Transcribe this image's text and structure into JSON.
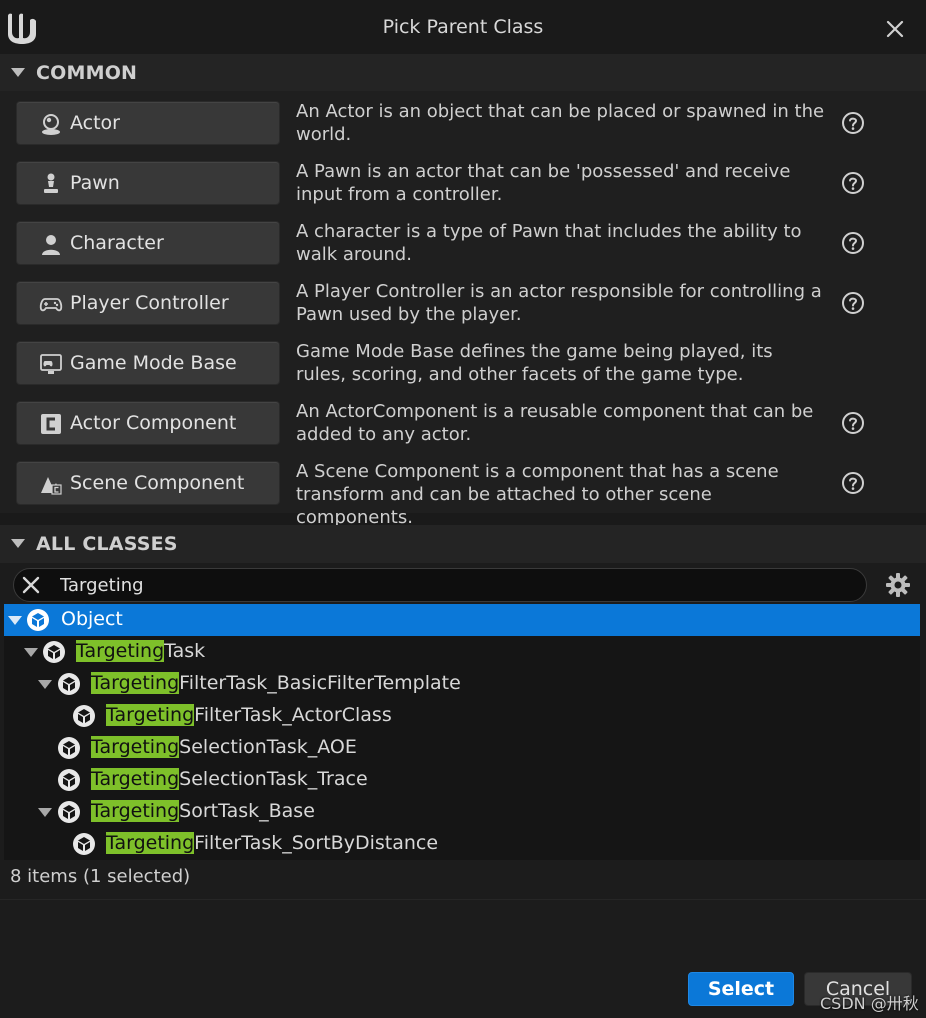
{
  "window": {
    "title": "Pick Parent Class",
    "logo": "unreal-logo",
    "close_icon": "close-icon"
  },
  "common": {
    "header": "COMMON",
    "items": [
      {
        "label": "Actor",
        "icon": "actor-icon",
        "description": "An Actor is an object that can be placed or spawned in the world.",
        "has_help": true
      },
      {
        "label": "Pawn",
        "icon": "pawn-icon",
        "description": "A Pawn is an actor that can be 'possessed' and receive input from a controller.",
        "has_help": true
      },
      {
        "label": "Character",
        "icon": "character-icon",
        "description": "A character is a type of Pawn that includes the ability to walk around.",
        "has_help": true
      },
      {
        "label": "Player Controller",
        "icon": "gamepad-icon",
        "description": "A Player Controller is an actor responsible for controlling a Pawn used by the player.",
        "has_help": true
      },
      {
        "label": "Game Mode Base",
        "icon": "game-mode-icon",
        "description": "Game Mode Base defines the game being played, its rules, scoring, and other facets of the game type.",
        "has_help": false
      },
      {
        "label": "Actor Component",
        "icon": "actor-component-icon",
        "description": "An ActorComponent is a reusable component that can be added to any actor.",
        "has_help": true
      },
      {
        "label": "Scene Component",
        "icon": "scene-component-icon",
        "description": "A Scene Component is a component that has a scene transform and can be attached to other scene components.",
        "has_help": true
      }
    ]
  },
  "all_classes": {
    "header": "ALL CLASSES",
    "search": {
      "value": "Targeting",
      "placeholder": ""
    },
    "tree": [
      {
        "highlight": "",
        "rest": "Object",
        "expanded": true,
        "selected": true
      },
      {
        "highlight": "Targeting",
        "rest": "Task",
        "expanded": true,
        "selected": false
      },
      {
        "highlight": "Targeting",
        "rest": "FilterTask_BasicFilterTemplate",
        "expanded": true,
        "selected": false
      },
      {
        "highlight": "Targeting",
        "rest": "FilterTask_ActorClass",
        "expanded": false,
        "selected": false
      },
      {
        "highlight": "Targeting",
        "rest": "SelectionTask_AOE",
        "expanded": false,
        "selected": false
      },
      {
        "highlight": "Targeting",
        "rest": "SelectionTask_Trace",
        "expanded": false,
        "selected": false
      },
      {
        "highlight": "Targeting",
        "rest": "SortTask_Base",
        "expanded": true,
        "selected": false
      },
      {
        "highlight": "Targeting",
        "rest": "FilterTask_SortByDistance",
        "expanded": false,
        "selected": false
      }
    ],
    "status": "8 items (1 selected)"
  },
  "buttons": {
    "select": "Select",
    "cancel": "Cancel"
  },
  "watermark": "CSDN @卅秋",
  "colors": {
    "accent": "#0b78d8",
    "highlight": "#7ec02a",
    "background": "#1a1a1a"
  }
}
